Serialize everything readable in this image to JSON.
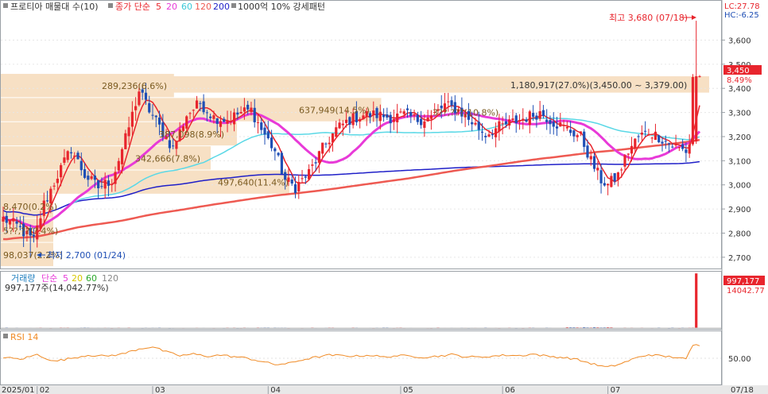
{
  "legend": {
    "main": {
      "box_label": "프로티아 매물대 수(10)",
      "close_label": "종가 단순",
      "ma": [
        "5",
        "20",
        "60",
        "120",
        "200"
      ],
      "band_label": "1000억 10% 강세패턴"
    },
    "volume": {
      "label": "거래량",
      "ma_label": "단순",
      "ma": [
        "5",
        "20",
        "60",
        "120"
      ],
      "current": "997,177주(14,042.77%)"
    },
    "rsi": {
      "label": "RSI 14"
    }
  },
  "indicators": {
    "lc": "LC:27.78",
    "hc": "HC:-6.25"
  },
  "price_tag": {
    "value": "3,450",
    "pct": "8.49%"
  },
  "volume_tag": {
    "value": "997,177",
    "pct": "14042.77"
  },
  "annotations": {
    "high": "최고 3,680 (07/18)",
    "low": "최저 2,700 (01/24)"
  },
  "colors": {
    "up": "#e8252d",
    "down": "#1f4fb5",
    "ma5": "#e8252d",
    "ma20": "#e83ad8",
    "ma60": "#5ad8e6",
    "ma120": "#ee5a52",
    "ma200": "#1f1fc8",
    "band": "#f7e0c4",
    "rsi": "#f08a24",
    "volume_tag_bg": "#e8252d"
  },
  "chart_data": [
    {
      "type": "candlestick",
      "title": "",
      "y_axis": {
        "ticks": [
          2700,
          2800,
          2900,
          3000,
          3100,
          3200,
          3300,
          3400,
          3500,
          3600
        ],
        "ylim": [
          2660,
          3720
        ],
        "tick_labels": [
          "2,700",
          "2,800",
          "2,900",
          "3,000",
          "3,100",
          "3,200",
          "3,300",
          "3,400",
          "3,500",
          "3,600"
        ]
      },
      "x_axis": {
        "labels": [
          "2025/01",
          "02",
          "03",
          "04",
          "05",
          "06",
          "07",
          "07/18"
        ],
        "label_positions": [
          0,
          10,
          44,
          78,
          117,
          147,
          178,
          205
        ],
        "n_points": 206
      },
      "series": [
        {
          "name": "종가 단순 5",
          "kind": "ma",
          "period": 5
        },
        {
          "name": "20",
          "kind": "ma",
          "period": 20
        },
        {
          "name": "60",
          "kind": "ma",
          "period": 60
        },
        {
          "name": "120",
          "kind": "ma",
          "period": 120
        },
        {
          "name": "200",
          "kind": "ma",
          "period": 200
        }
      ],
      "anchors_close": [
        [
          0,
          2860
        ],
        [
          4,
          2830
        ],
        [
          7,
          2790
        ],
        [
          9,
          2770
        ],
        [
          12,
          2920
        ],
        [
          16,
          3040
        ],
        [
          20,
          3150
        ],
        [
          24,
          3040
        ],
        [
          28,
          2990
        ],
        [
          32,
          3020
        ],
        [
          36,
          3190
        ],
        [
          40,
          3390
        ],
        [
          43,
          3310
        ],
        [
          46,
          3240
        ],
        [
          50,
          3150
        ],
        [
          54,
          3290
        ],
        [
          58,
          3340
        ],
        [
          62,
          3280
        ],
        [
          66,
          3270
        ],
        [
          70,
          3300
        ],
        [
          73,
          3310
        ],
        [
          76,
          3230
        ],
        [
          80,
          3140
        ],
        [
          83,
          3020
        ],
        [
          86,
          2990
        ],
        [
          90,
          3050
        ],
        [
          94,
          3150
        ],
        [
          98,
          3230
        ],
        [
          102,
          3270
        ],
        [
          106,
          3290
        ],
        [
          110,
          3290
        ],
        [
          114,
          3280
        ],
        [
          118,
          3290
        ],
        [
          122,
          3270
        ],
        [
          126,
          3280
        ],
        [
          130,
          3330
        ],
        [
          134,
          3310
        ],
        [
          138,
          3260
        ],
        [
          142,
          3210
        ],
        [
          146,
          3240
        ],
        [
          150,
          3260
        ],
        [
          154,
          3280
        ],
        [
          158,
          3300
        ],
        [
          162,
          3260
        ],
        [
          166,
          3230
        ],
        [
          170,
          3200
        ],
        [
          173,
          3100
        ],
        [
          176,
          3020
        ],
        [
          178,
          3000
        ],
        [
          181,
          3040
        ],
        [
          184,
          3140
        ],
        [
          187,
          3200
        ],
        [
          190,
          3220
        ],
        [
          193,
          3200
        ],
        [
          196,
          3170
        ],
        [
          199,
          3150
        ],
        [
          201,
          3140
        ],
        [
          202,
          3170
        ],
        [
          203,
          3450
        ]
      ],
      "ohlc_last": {
        "open": 3180,
        "high": 3680,
        "low": 3170,
        "close": 3450
      },
      "price_extremes": {
        "high": 3680,
        "high_index": 203,
        "low": 2700,
        "low_index": 8
      },
      "volume_profile": [
        {
          "label": "98,037(2.2%)",
          "from": 2660,
          "to": 2760,
          "fraction": 0.02
        },
        {
          "label": "5??,??(?.4%)",
          "from": 2760,
          "to": 2860,
          "fraction": 0.02
        },
        {
          "label": "8,470(0.2%)",
          "from": 2860,
          "to": 2960,
          "fraction": 0.02
        },
        {
          "label": "497,640(11.4%)",
          "from": 2960,
          "to": 3060,
          "fraction": 0.11
        },
        {
          "label": "342,666(7.8%)",
          "from": 3060,
          "to": 3160,
          "fraction": 0.08
        },
        {
          "label": "387,098(8.9%)",
          "from": 3160,
          "to": 3260,
          "fraction": 0.09
        },
        {
          "label": "637,949(14.5%)",
          "from": 3260,
          "to": 3360,
          "fraction": 0.145
        },
        {
          "label": "289,236(6.6%)",
          "from": 3360,
          "to": 3460,
          "fraction": 0.066
        },
        {
          "label": "1,180,917(27.0%)(3,450.00 ~ 3,379.00)",
          "from": 3379,
          "to": 3450,
          "fraction": 0.27
        }
      ],
      "volume_profile_last": "3??,???(10.8%)"
    },
    {
      "type": "bar",
      "title": "거래량",
      "last_volume": 997177,
      "last_volume_pct_change": 14042.77,
      "ylim": [
        0,
        1000000
      ]
    },
    {
      "type": "line",
      "title": "RSI 14",
      "y_ticks": [
        50
      ],
      "tick_labels": [
        "50.00"
      ],
      "ylim": [
        0,
        100
      ],
      "anchors": [
        [
          0,
          52
        ],
        [
          5,
          48
        ],
        [
          10,
          57
        ],
        [
          15,
          44
        ],
        [
          20,
          50
        ],
        [
          25,
          56
        ],
        [
          30,
          54
        ],
        [
          35,
          58
        ],
        [
          40,
          68
        ],
        [
          44,
          72
        ],
        [
          48,
          62
        ],
        [
          52,
          55
        ],
        [
          56,
          58
        ],
        [
          60,
          54
        ],
        [
          64,
          56
        ],
        [
          68,
          53
        ],
        [
          72,
          50
        ],
        [
          76,
          44
        ],
        [
          80,
          38
        ],
        [
          84,
          40
        ],
        [
          88,
          47
        ],
        [
          92,
          52
        ],
        [
          96,
          56
        ],
        [
          100,
          55
        ],
        [
          104,
          54
        ],
        [
          108,
          56
        ],
        [
          112,
          52
        ],
        [
          116,
          55
        ],
        [
          120,
          54
        ],
        [
          124,
          52
        ],
        [
          128,
          54
        ],
        [
          132,
          57
        ],
        [
          136,
          53
        ],
        [
          140,
          52
        ],
        [
          144,
          54
        ],
        [
          148,
          56
        ],
        [
          152,
          55
        ],
        [
          156,
          58
        ],
        [
          160,
          54
        ],
        [
          164,
          52
        ],
        [
          168,
          49
        ],
        [
          172,
          42
        ],
        [
          176,
          35
        ],
        [
          178,
          33
        ],
        [
          182,
          40
        ],
        [
          186,
          50
        ],
        [
          190,
          57
        ],
        [
          194,
          54
        ],
        [
          198,
          52
        ],
        [
          201,
          48
        ],
        [
          203,
          75
        ]
      ]
    }
  ]
}
